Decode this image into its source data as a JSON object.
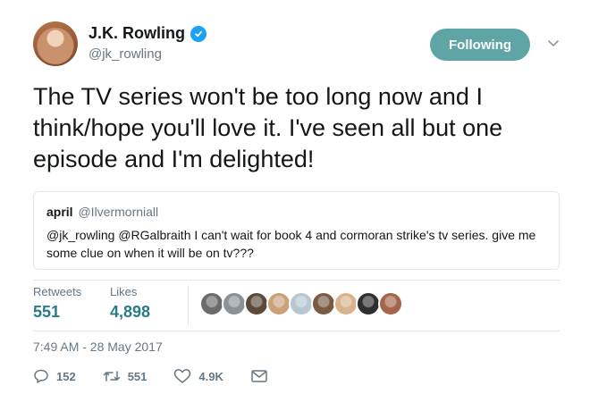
{
  "author": {
    "name": "J.K. Rowling",
    "handle": "@jk_rowling",
    "verified": true
  },
  "follow_button": {
    "label": "Following",
    "color": "#5fa5a5"
  },
  "tweet": {
    "text": "The TV series won't be too long now and I think/hope you'll love it. I've seen all but one episode and I'm delighted!"
  },
  "quoted_tweet": {
    "name": "april",
    "handle": "@Ilvermorniall",
    "text": "@jk_rowling @RGalbraith I can't wait for book 4 and cormoran strike's tv series. give me some clue on when it will be on tv???"
  },
  "stats": {
    "retweets_label": "Retweets",
    "retweets_value": "551",
    "likes_label": "Likes",
    "likes_value": "4,898"
  },
  "likers": [
    {
      "name": "liker-1",
      "color": "#6b6b6b"
    },
    {
      "name": "liker-2",
      "color": "#8c9197"
    },
    {
      "name": "liker-3",
      "color": "#5b4a3a"
    },
    {
      "name": "liker-4",
      "color": "#c9a27a"
    },
    {
      "name": "liker-5",
      "color": "#b8c6d1"
    },
    {
      "name": "liker-6",
      "color": "#7a5a44"
    },
    {
      "name": "liker-7",
      "color": "#d9b38c"
    },
    {
      "name": "liker-8",
      "color": "#2f2f2f"
    },
    {
      "name": "liker-9",
      "color": "#a4664a"
    }
  ],
  "timestamp": "7:49 AM - 28 May 2017",
  "actions": {
    "reply_count": "152",
    "retweet_count": "551",
    "like_count": "4.9K"
  },
  "icons": {
    "verified": "verified-badge-icon",
    "chevron": "chevron-down-icon",
    "reply": "reply-icon",
    "retweet": "retweet-icon",
    "like": "heart-icon",
    "dm": "envelope-icon"
  }
}
